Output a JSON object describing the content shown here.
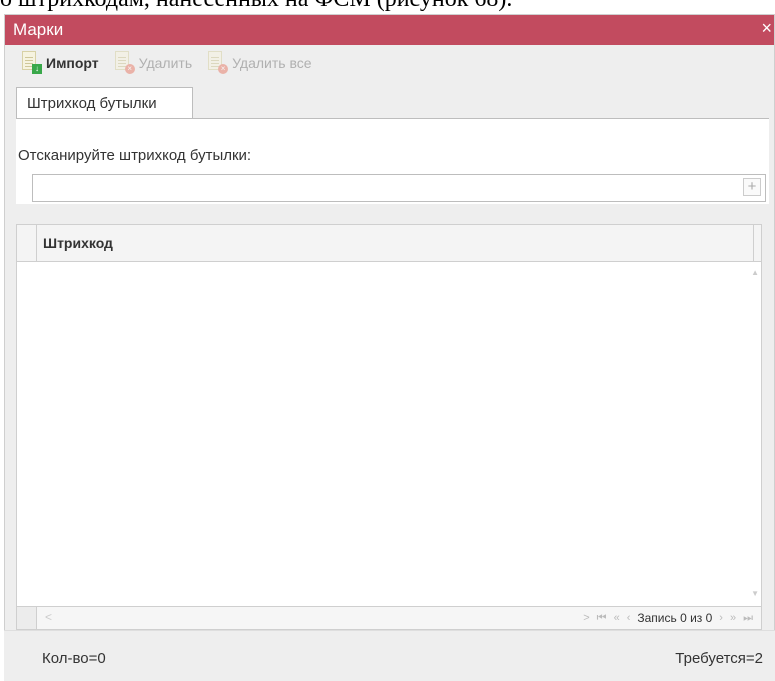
{
  "document": {
    "caption": "о штрихкодам, нанесенных на ФСМ (рисунок 68)."
  },
  "window": {
    "title": "Марки",
    "close_glyph": "×"
  },
  "toolbar": {
    "import_label": "Импорт",
    "delete_label": "Удалить",
    "delete_all_label": "Удалить все",
    "icons": [
      "document-import-icon",
      "document-delete-icon",
      "document-delete-all-icon"
    ]
  },
  "tabs": [
    {
      "label": "Штрихкод бутылки",
      "active": true
    }
  ],
  "scan": {
    "label": "Отсканируйте штрихкод бутылки:",
    "value": "",
    "add_glyph": "+"
  },
  "grid": {
    "columns": [
      "Штрихкод"
    ],
    "rows": []
  },
  "pager": {
    "record_text": "Запись 0 из 0",
    "scroll_left": "<",
    "scroll_right": ">",
    "first": "⏮",
    "prev_page": "«",
    "prev": "‹",
    "next": "›",
    "next_page": "»",
    "last": "⏭"
  },
  "footer": {
    "count": "Кол-во=0",
    "required": "Требуется=2"
  },
  "colors": {
    "title_bar": "#c24b5f"
  }
}
